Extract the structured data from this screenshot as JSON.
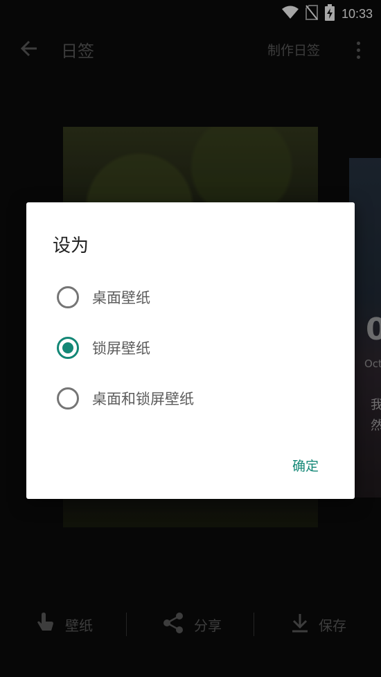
{
  "status_bar": {
    "time": "10:33",
    "icons": [
      "wifi-icon",
      "no-sim-icon",
      "battery-charging-icon"
    ]
  },
  "app_bar": {
    "title": "日签",
    "make_label": "制作日签",
    "icons": [
      "back-arrow-icon",
      "more-vert-icon"
    ]
  },
  "background_card_side": {
    "big_text": "0",
    "small_text": "Oct",
    "line1": "我",
    "line2": "然"
  },
  "dialog": {
    "title": "设为",
    "options": [
      {
        "label": "桌面壁纸",
        "checked": false
      },
      {
        "label": "锁屏壁纸",
        "checked": true
      },
      {
        "label": "桌面和锁屏壁纸",
        "checked": false
      }
    ],
    "confirm_label": "确定",
    "accent_color": "#138776"
  },
  "bottom_bar": {
    "items": [
      {
        "label": "壁纸",
        "icon": "touch-hand-icon"
      },
      {
        "label": "分享",
        "icon": "share-icon"
      },
      {
        "label": "保存",
        "icon": "download-icon"
      }
    ]
  }
}
